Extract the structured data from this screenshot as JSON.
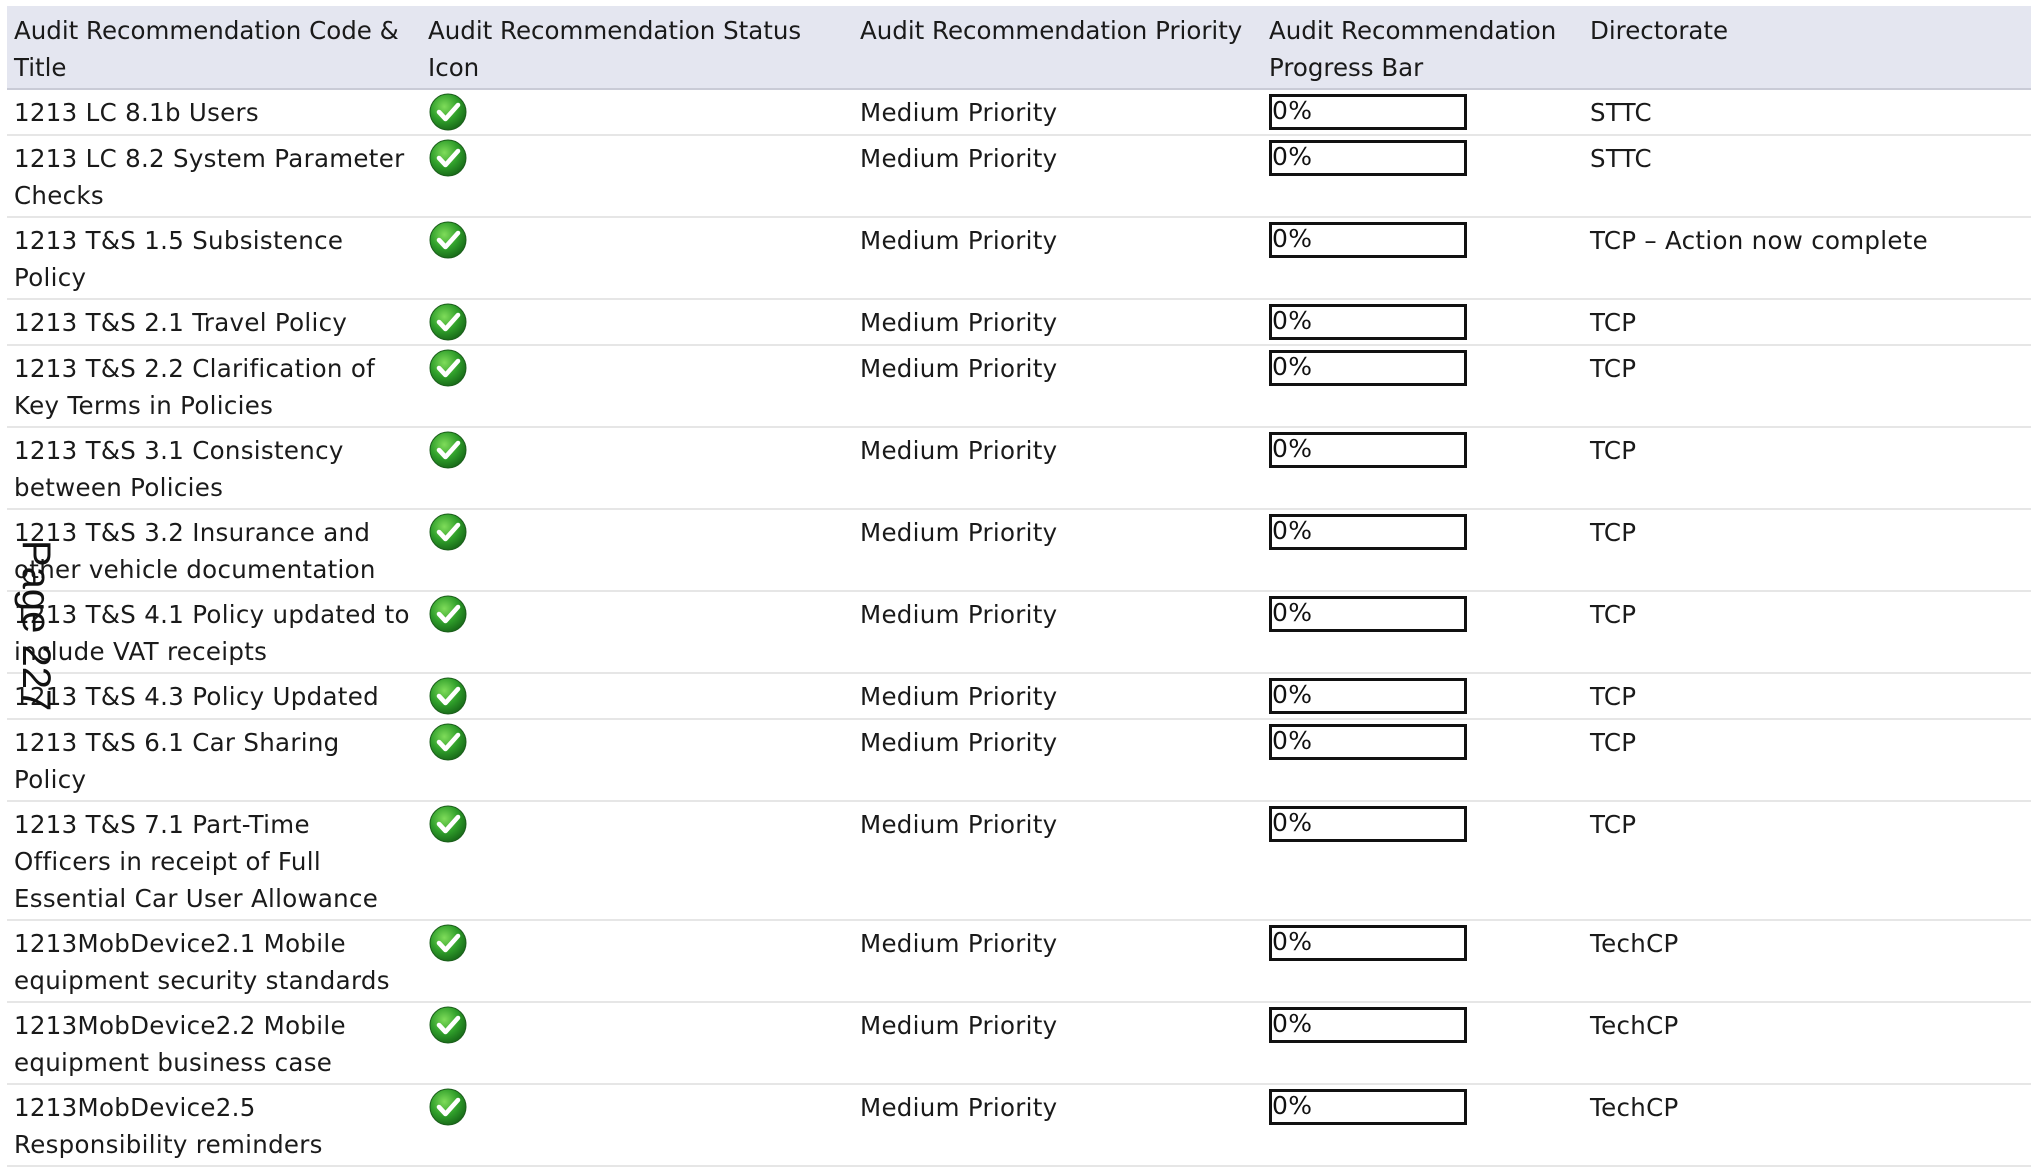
{
  "table": {
    "columns": [
      "Audit Recommendation Code & Title",
      "Audit Recommendation Status Icon",
      "Audit Recommendation Priority",
      "Audit Recommendation Progress Bar",
      "Directorate"
    ],
    "rows": [
      {
        "title": "1213 LC 8.1b Users",
        "status_icon": "green-checkmark-icon",
        "priority": "Medium Priority",
        "progress": "0%",
        "progress_value": 0,
        "directorate": "STTC"
      },
      {
        "title": "1213 LC 8.2 System Parameter Checks",
        "status_icon": "green-checkmark-icon",
        "priority": "Medium Priority",
        "progress": "0%",
        "progress_value": 0,
        "directorate": "STTC"
      },
      {
        "title": "1213 T&S 1.5 Subsistence Policy",
        "status_icon": "green-checkmark-icon",
        "priority": "Medium Priority",
        "progress": "0%",
        "progress_value": 0,
        "directorate": "TCP – Action now complete"
      },
      {
        "title": "1213 T&S 2.1 Travel Policy",
        "status_icon": "green-checkmark-icon",
        "priority": "Medium Priority",
        "progress": "0%",
        "progress_value": 0,
        "directorate": "TCP"
      },
      {
        "title": "1213 T&S 2.2 Clarification of Key Terms in Policies",
        "status_icon": "green-checkmark-icon",
        "priority": "Medium Priority",
        "progress": "0%",
        "progress_value": 0,
        "directorate": "TCP"
      },
      {
        "title": "1213 T&S 3.1 Consistency between Policies",
        "status_icon": "green-checkmark-icon",
        "priority": "Medium Priority",
        "progress": "0%",
        "progress_value": 0,
        "directorate": "TCP"
      },
      {
        "title": "1213 T&S 3.2 Insurance and other vehicle documentation",
        "status_icon": "green-checkmark-icon",
        "priority": "Medium Priority",
        "progress": "0%",
        "progress_value": 0,
        "directorate": "TCP"
      },
      {
        "title": "1213 T&S 4.1 Policy updated to include VAT receipts",
        "status_icon": "green-checkmark-icon",
        "priority": "Medium Priority",
        "progress": "0%",
        "progress_value": 0,
        "directorate": "TCP"
      },
      {
        "title": "1213 T&S 4.3 Policy Updated",
        "status_icon": "green-checkmark-icon",
        "priority": "Medium Priority",
        "progress": "0%",
        "progress_value": 0,
        "directorate": "TCP"
      },
      {
        "title": "1213 T&S 6.1 Car Sharing Policy",
        "status_icon": "green-checkmark-icon",
        "priority": "Medium Priority",
        "progress": "0%",
        "progress_value": 0,
        "directorate": "TCP"
      },
      {
        "title": "1213 T&S 7.1 Part-Time Officers in receipt of Full Essential Car User Allowance",
        "status_icon": "green-checkmark-icon",
        "priority": "Medium Priority",
        "progress": "0%",
        "progress_value": 0,
        "directorate": "TCP"
      },
      {
        "title": "1213MobDevice2.1 Mobile equipment security standards",
        "status_icon": "green-checkmark-icon",
        "priority": "Medium Priority",
        "progress": "0%",
        "progress_value": 0,
        "directorate": "TechCP"
      },
      {
        "title": "1213MobDevice2.2 Mobile equipment business case",
        "status_icon": "green-checkmark-icon",
        "priority": "Medium Priority",
        "progress": "0%",
        "progress_value": 0,
        "directorate": "TechCP"
      },
      {
        "title": "1213MobDevice2.5 Responsibility reminders",
        "status_icon": "green-checkmark-icon",
        "priority": "Medium Priority",
        "progress": "0%",
        "progress_value": 0,
        "directorate": "TechCP"
      }
    ]
  },
  "page_stamp": "Page 227",
  "colors": {
    "header_bg": "#e4e6f0",
    "check_green": "#2e9a2e"
  }
}
